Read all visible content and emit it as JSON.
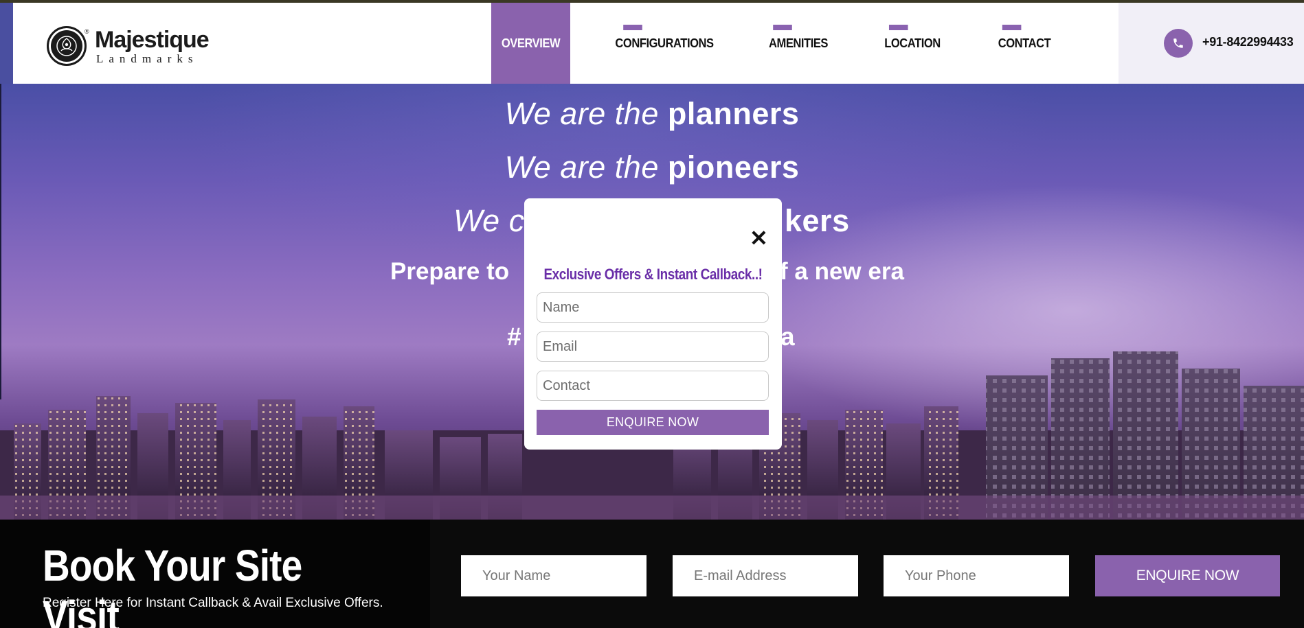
{
  "brand": {
    "name": "Majestique",
    "sub": "Landmarks",
    "reg": "®"
  },
  "nav": {
    "items": [
      {
        "label": "OVERVIEW",
        "active": true
      },
      {
        "label": "CONFIGURATIONS",
        "active": false
      },
      {
        "label": "AMENITIES",
        "active": false
      },
      {
        "label": "LOCATION",
        "active": false
      },
      {
        "label": "CONTACT",
        "active": false
      }
    ]
  },
  "phone": {
    "number": "+91-8422994433",
    "icon": "phone-icon"
  },
  "hero": {
    "line1_italic": "We are the",
    "line1_bold": "planners",
    "line2_italic": "We are the",
    "line2_bold": "pioneers",
    "line3_left_italic": "We c",
    "line3_right_bold": "kers",
    "line4_left": "Prepare to",
    "line4_right": "f a new era",
    "line5_left": "#",
    "line5_right": "a"
  },
  "modal": {
    "close_symbol": "✕",
    "title": "Exclusive Offers & Instant Callback..!",
    "name_placeholder": "Name",
    "email_placeholder": "Email",
    "contact_placeholder": "Contact",
    "button_label": "ENQUIRE NOW"
  },
  "booking": {
    "title": "Book Your Site Visit",
    "subtitle": "Register Here for Instant Callback & Avail Exclusive Offers.",
    "name_placeholder": "Your Name",
    "email_placeholder": "E-mail Address",
    "phone_placeholder": "Your Phone",
    "button_label": "ENQUIRE NOW"
  },
  "colors": {
    "accent": "#8a62ad",
    "modal_title": "#6a2ea8",
    "footer_bg": "#0b0b0b"
  }
}
